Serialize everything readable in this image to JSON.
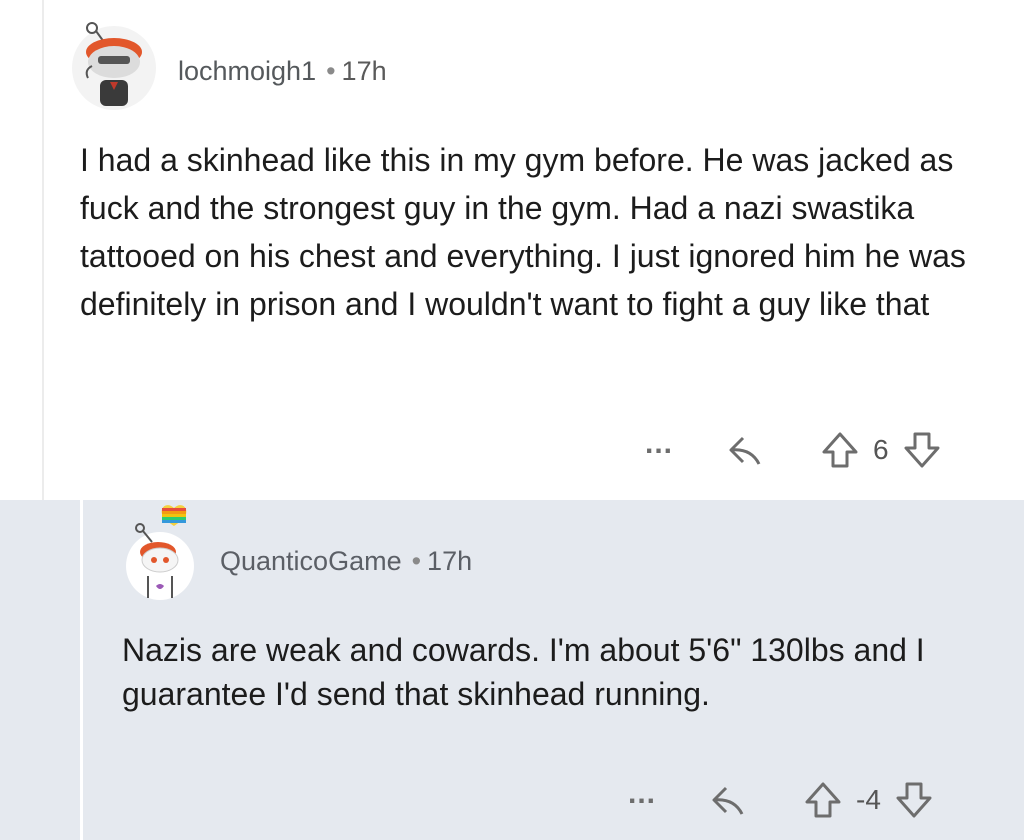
{
  "comments": [
    {
      "username": "lochmoigh1",
      "separator": "•",
      "age": "17h",
      "body": "I had a skinhead like this in my gym before. He was jacked as fuck and the strongest guy in the gym. Had a nazi swastika tattooed on his chest and everything. I just ignored him he was definitely in prison and I wouldn't want to fight a guy like that",
      "more_label": "...",
      "score": "6"
    },
    {
      "username": "QuanticoGame",
      "separator": "•",
      "age": "17h",
      "body": "Nazis are weak and cowards. I'm about 5'6\" 130lbs and I guarantee I'd send that skinhead running.",
      "more_label": "...",
      "score": "-4"
    }
  ],
  "icons": {
    "more": "more-options-icon",
    "reply": "reply-icon",
    "upvote": "upvote-arrow-icon",
    "downvote": "downvote-arrow-icon"
  },
  "colors": {
    "reply_background": "#e5e9ef",
    "thread_line": "#ececec",
    "meta_text": "#5a5a5a",
    "icon": "#6d6d6d"
  }
}
